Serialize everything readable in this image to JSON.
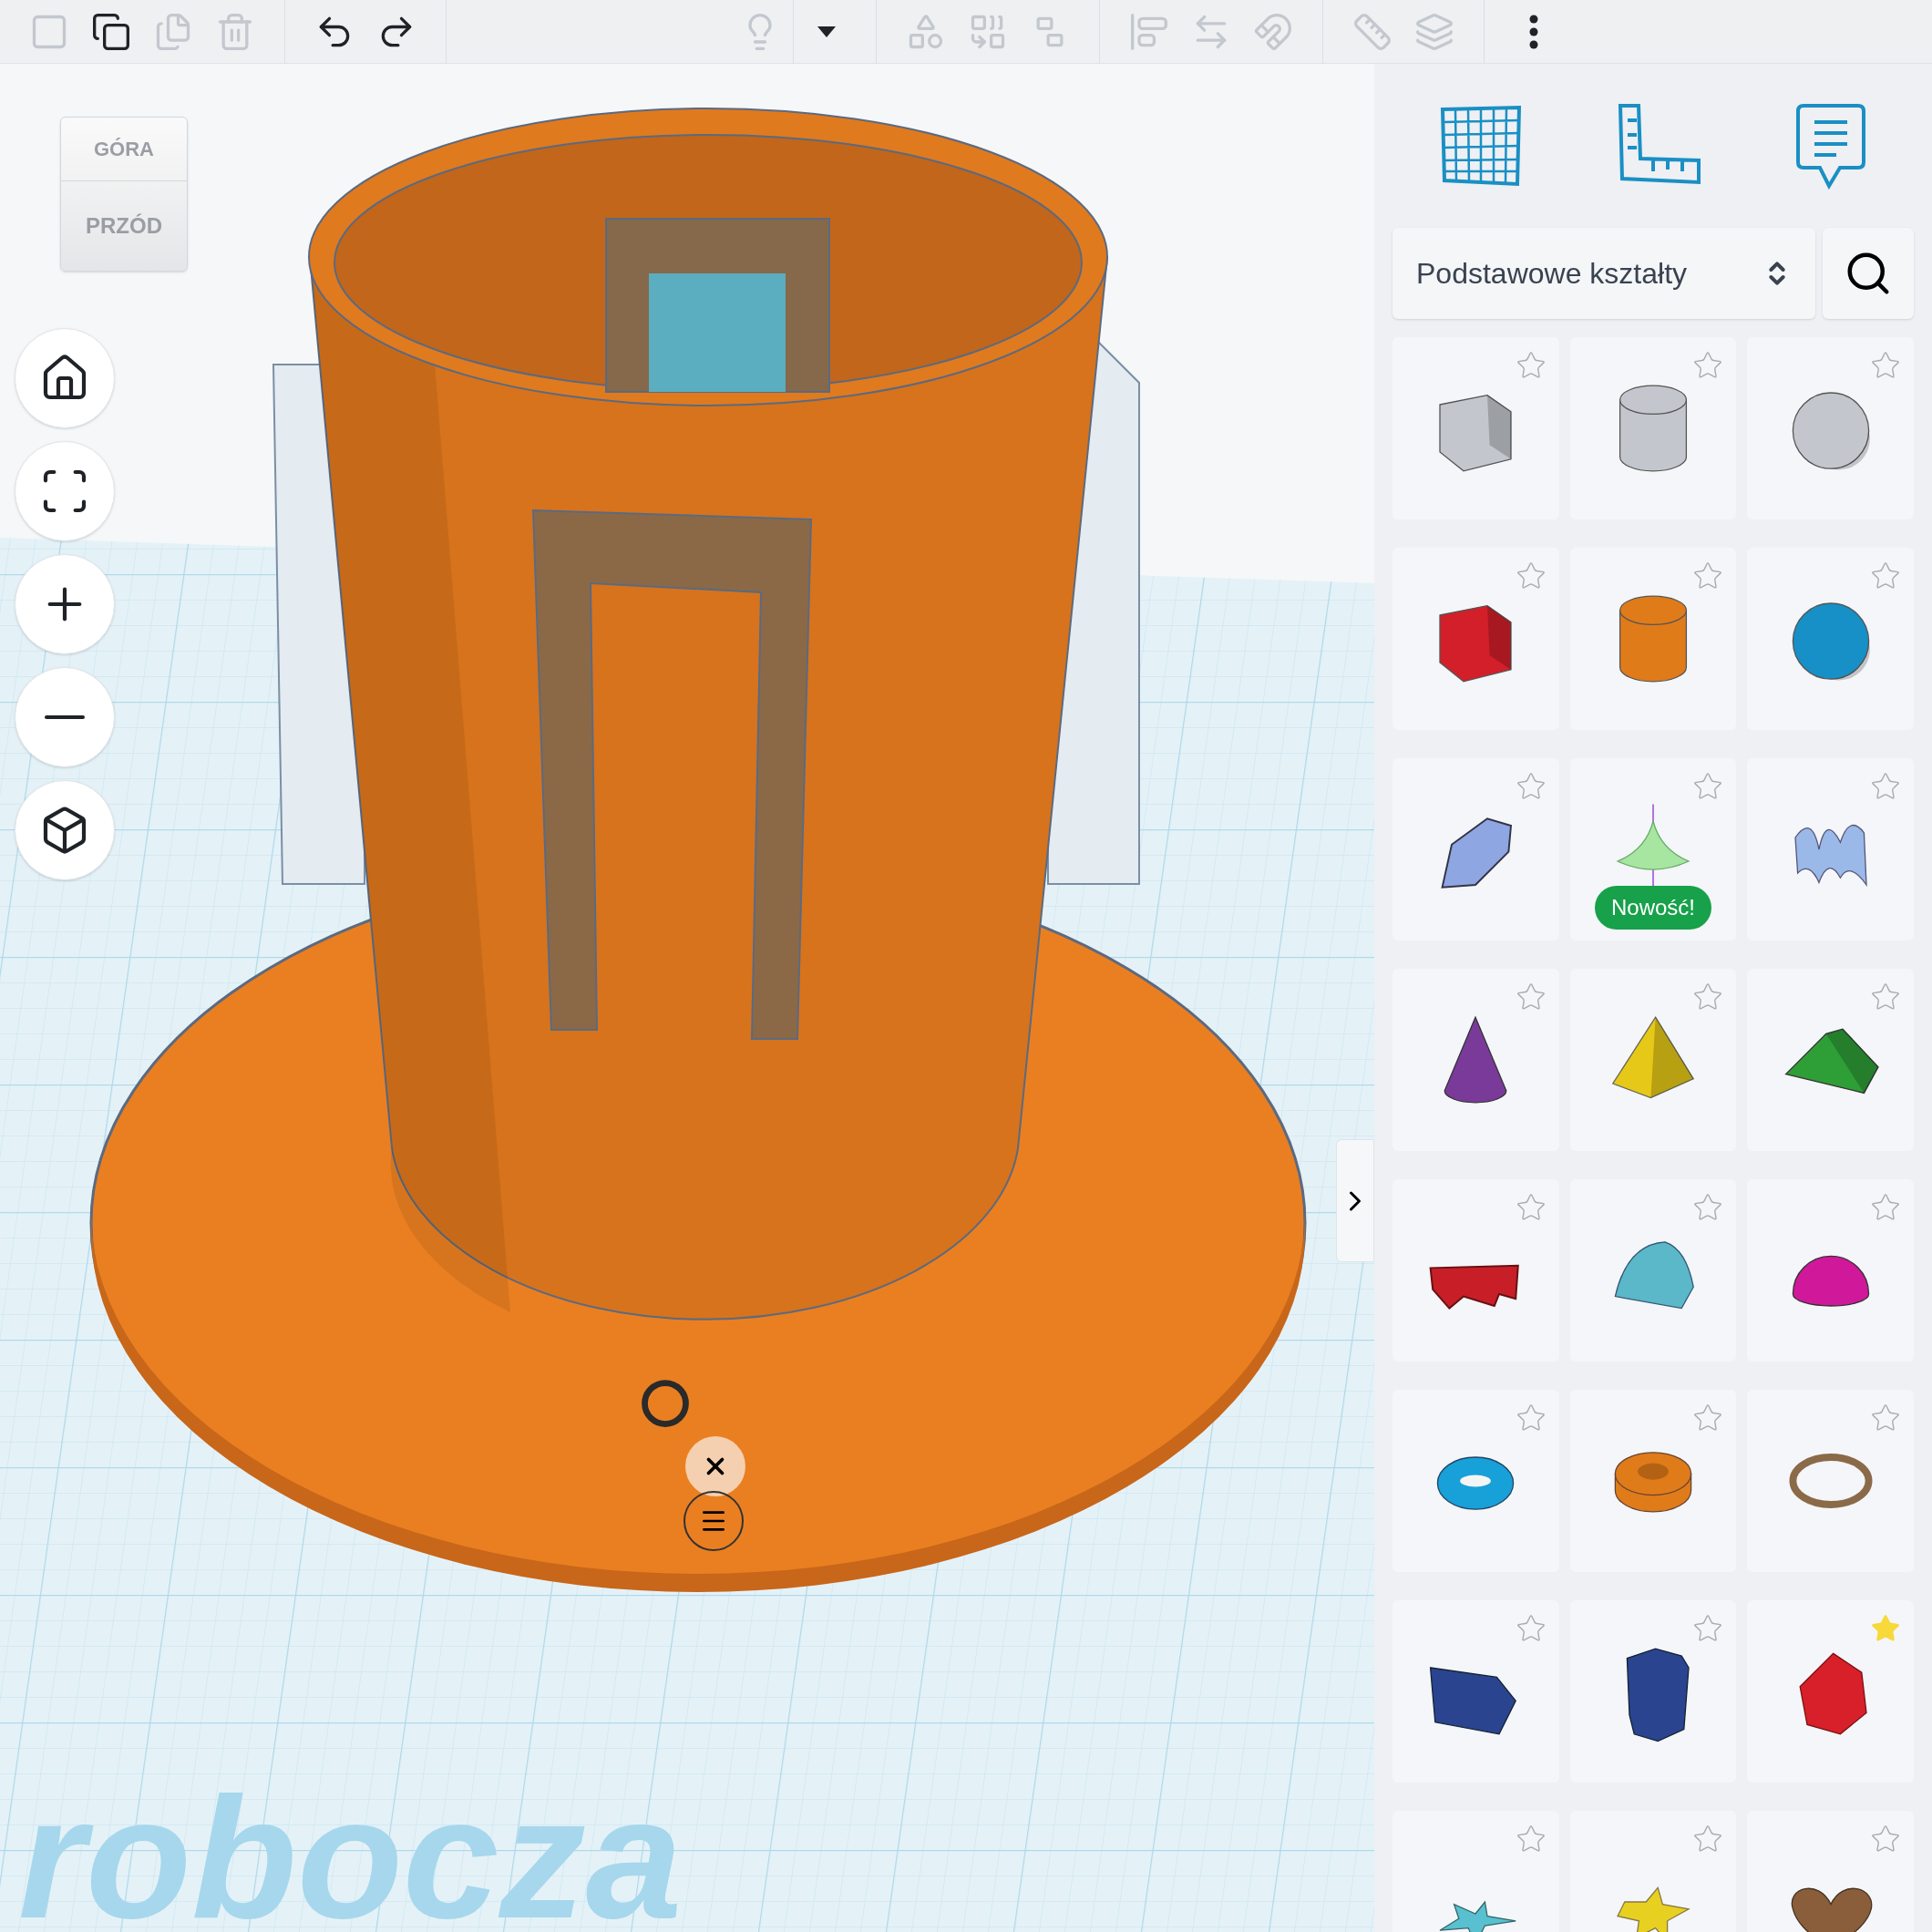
{
  "toolbar": [
    {
      "kind": "new",
      "disabled": true
    },
    {
      "kind": "copy",
      "disabled": false
    },
    {
      "kind": "duplicate",
      "disabled": true
    },
    {
      "kind": "delete",
      "disabled": true
    },
    {
      "kind": "undo",
      "disabled": false
    },
    {
      "kind": "redo",
      "disabled": false
    },
    {
      "kind": "light",
      "disabled": true
    },
    {
      "kind": "dropdown",
      "disabled": false
    },
    {
      "kind": "hole",
      "disabled": true
    },
    {
      "kind": "group",
      "disabled": true
    },
    {
      "kind": "ungroup",
      "disabled": true
    },
    {
      "kind": "align",
      "disabled": true
    },
    {
      "kind": "mirror",
      "disabled": true
    },
    {
      "kind": "magnet",
      "disabled": true
    },
    {
      "kind": "ruler",
      "disabled": true
    },
    {
      "kind": "workplane",
      "disabled": true
    },
    {
      "kind": "more",
      "disabled": false
    }
  ],
  "view_cube": {
    "top": "GÓRA",
    "front": "PRZÓD"
  },
  "workplane_label": "robocza",
  "panel": {
    "library": "Podstawowe kształty",
    "shapes": [
      {
        "kind": "box",
        "color": "#c3c7cd",
        "favorite": false
      },
      {
        "kind": "cylinder",
        "color": "#c3c7cd",
        "favorite": false
      },
      {
        "kind": "sphere",
        "color": "#c3c7cd",
        "favorite": false
      },
      {
        "kind": "box",
        "color": "#d21f2a",
        "favorite": false
      },
      {
        "kind": "cylinder",
        "color": "#e07b1a",
        "favorite": false
      },
      {
        "kind": "sphere",
        "color": "#1690c6",
        "favorite": false
      },
      {
        "kind": "scribble",
        "color": "#8ea6e2",
        "favorite": false
      },
      {
        "kind": "spinner",
        "color": "#a6e6a0",
        "favorite": false,
        "badge": "Nowość!"
      },
      {
        "kind": "wave",
        "color": "#9ab8e8",
        "favorite": false
      },
      {
        "kind": "cone",
        "color": "#7a3a9a",
        "favorite": false
      },
      {
        "kind": "pyramid",
        "color": "#e6c818",
        "favorite": false
      },
      {
        "kind": "roof",
        "color": "#2e9e36",
        "favorite": false
      },
      {
        "kind": "letters",
        "color": "#c81e28",
        "favorite": false
      },
      {
        "kind": "half_cylinder",
        "color": "#5ab8c8",
        "favorite": false
      },
      {
        "kind": "half_sphere",
        "color": "#d0189a",
        "favorite": false
      },
      {
        "kind": "torus",
        "color": "#18a0d8",
        "favorite": false
      },
      {
        "kind": "tube",
        "color": "#e07b1a",
        "favorite": false
      },
      {
        "kind": "ring",
        "color": "#8a6a48",
        "favorite": false
      },
      {
        "kind": "prism",
        "color": "#2a4490",
        "favorite": false
      },
      {
        "kind": "hexagonal_prism",
        "color": "#2a4490",
        "favorite": false
      },
      {
        "kind": "polyhedron",
        "color": "#d8202a",
        "favorite": true
      },
      {
        "kind": "flat_star",
        "color": "#58c0d0",
        "favorite": false
      },
      {
        "kind": "star",
        "color": "#e8d020",
        "favorite": false
      },
      {
        "kind": "heart",
        "color": "#8a5e3a",
        "favorite": false
      }
    ]
  }
}
